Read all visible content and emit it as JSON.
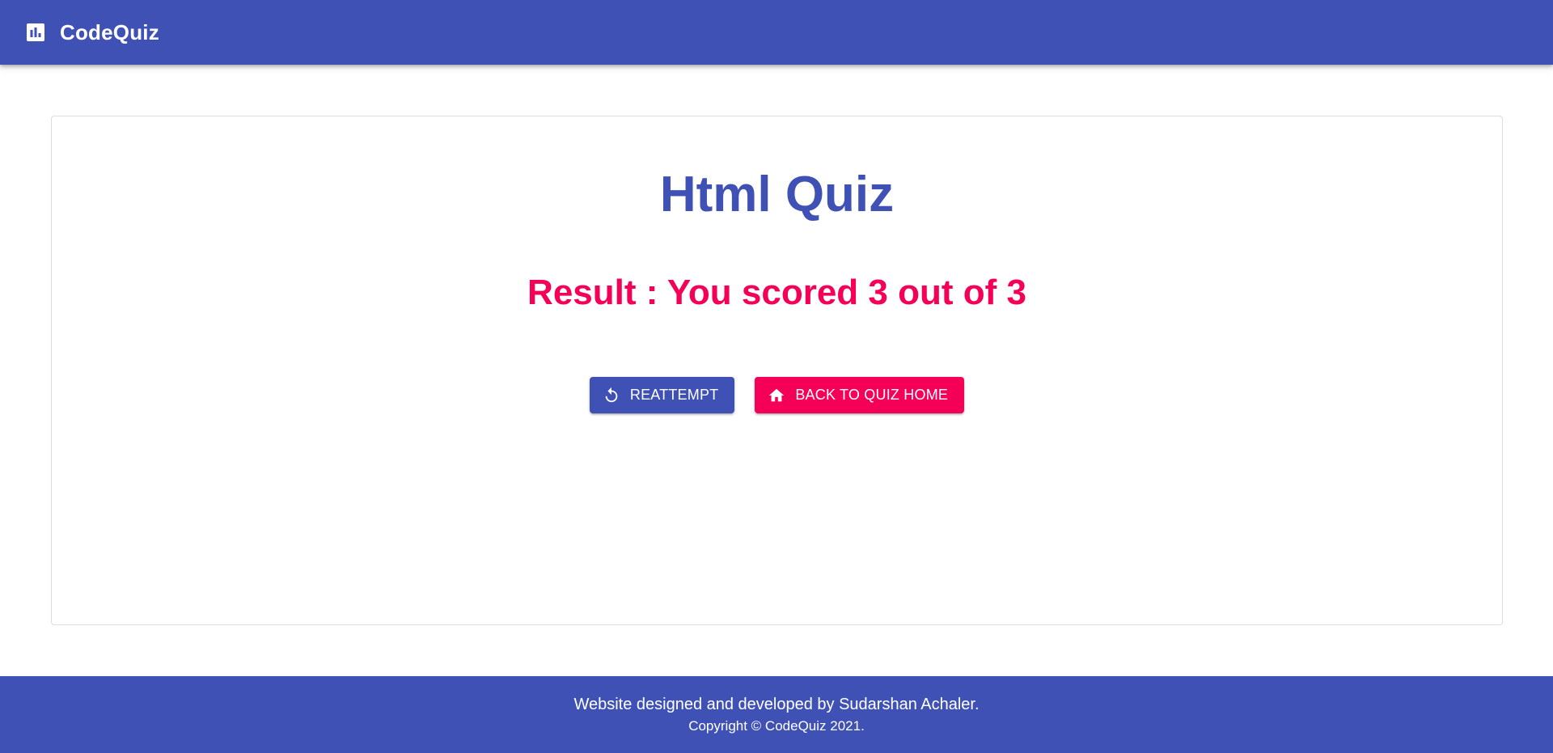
{
  "app": {
    "brand_name": "CodeQuiz",
    "brand_icon": "bar-chart-icon"
  },
  "quiz": {
    "title": "Html Quiz",
    "result_text": "Result : You scored 3 out of 3"
  },
  "actions": {
    "reattempt_label": "REATTEMPT",
    "reattempt_icon": "replay-icon",
    "home_label": "BACK TO QUIZ HOME",
    "home_icon": "home-icon"
  },
  "footer": {
    "credit": "Website designed and developed by Sudarshan Achaler.",
    "copyright": "Copyright © CodeQuiz 2021."
  },
  "colors": {
    "primary": "#3f51b5",
    "secondary": "#f50057",
    "background": "#ffffff",
    "card_border": "#dedede"
  }
}
